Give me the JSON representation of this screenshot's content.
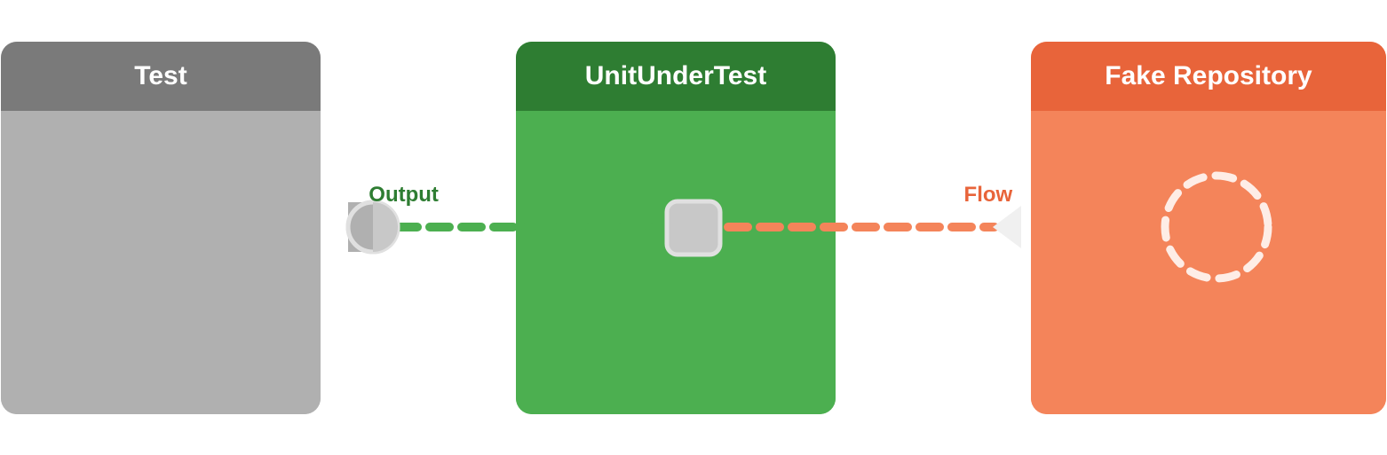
{
  "panels": {
    "test": {
      "title": "Test",
      "header_bg": "#7a7a7a",
      "body_bg": "#b0b0b0"
    },
    "uut": {
      "title": "UnitUnderTest",
      "header_bg": "#2e7d32",
      "body_bg": "#4caf50"
    },
    "fake": {
      "title": "Fake Repository",
      "header_bg": "#e8643a",
      "body_bg": "#f4845a"
    }
  },
  "labels": {
    "output": "Output",
    "flow": "Flow"
  }
}
